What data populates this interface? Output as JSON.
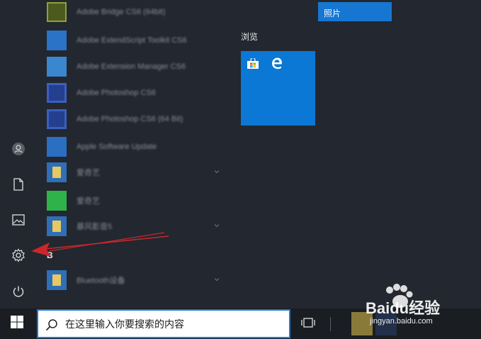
{
  "rail": {
    "items": [
      {
        "name": "account-icon"
      },
      {
        "name": "documents-icon"
      },
      {
        "name": "pictures-icon"
      },
      {
        "name": "settings-icon"
      },
      {
        "name": "power-icon"
      }
    ]
  },
  "app_list": {
    "items": [
      {
        "label": "Adobe Bridge CS6 (64bit)",
        "icon_color": "#6b7a2a"
      },
      {
        "label": "Adobe ExtendScript Toolkit CS6",
        "icon_color": "#2f6fb8"
      },
      {
        "label": "Adobe Extension Manager CS6",
        "icon_color": "#3b82c8"
      },
      {
        "label": "Adobe Photoshop CS6",
        "icon_color": "#2a4a9a"
      },
      {
        "label": "Adobe Photoshop CS6 (64 Bit)",
        "icon_color": "#2a4a9a"
      },
      {
        "label": "Apple Software Update",
        "icon_color": "#2f72c4"
      },
      {
        "label": "爱奇艺",
        "icon_color": "#d9b84a"
      },
      {
        "label": "爱奇艺",
        "icon_color": "#2fb24a"
      },
      {
        "label": "暴风影音5",
        "icon_color": "#d9b84a"
      },
      {
        "label": "Bluetooth设备",
        "icon_color": "#d9b84a"
      }
    ],
    "section_letter": "B"
  },
  "tiles": {
    "photo_tile_label": "照片",
    "group_title": "浏览"
  },
  "taskbar": {
    "search_placeholder": "在这里输入你要搜索的内容"
  },
  "watermark": {
    "text": "jingyan.baidu.com",
    "brand": "Baidu经验"
  },
  "colors": {
    "accent": "#0a78d4",
    "annotation_arrow": "#c8282c"
  }
}
